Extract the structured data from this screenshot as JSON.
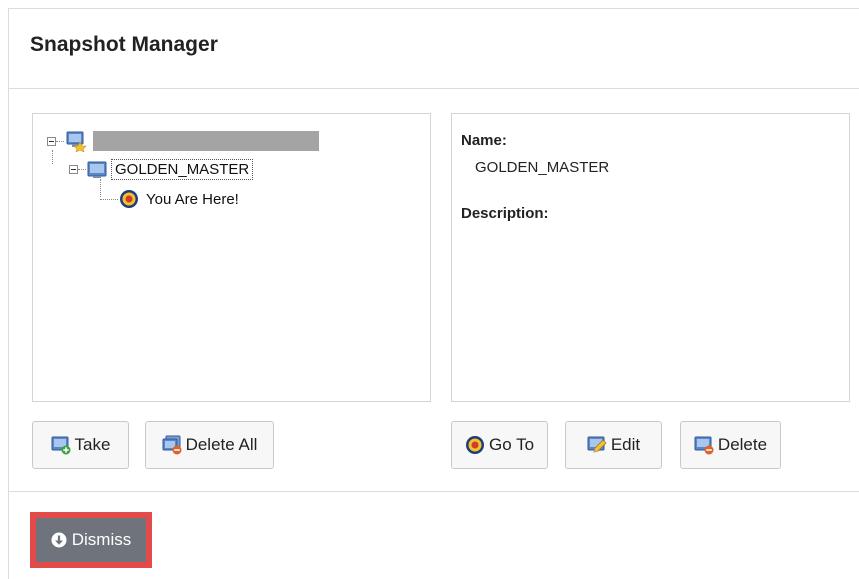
{
  "dialog": {
    "title": "Snapshot Manager"
  },
  "tree": {
    "host_name_redacted": "",
    "snapshot_node": "GOLDEN_MASTER",
    "current_state_node": "You Are Here!"
  },
  "details": {
    "name_label": "Name:",
    "name_value": "GOLDEN_MASTER",
    "description_label": "Description:",
    "description_value": ""
  },
  "buttons": {
    "take": "Take",
    "delete_all": "Delete All",
    "go_to": "Go To",
    "edit": "Edit",
    "delete": "Delete",
    "dismiss": "Dismiss"
  },
  "colors": {
    "dismiss_bg": "#6f747c",
    "highlight_outline": "#e34b4b",
    "redaction_bar": "#a4a4a4"
  },
  "icons": {
    "host": "vm-host-icon",
    "snapshot": "snapshot-icon",
    "you_are_here": "target-icon",
    "take": "take-snapshot-icon",
    "delete_all": "delete-all-snapshots-icon",
    "go_to": "target-icon",
    "edit": "edit-snapshot-icon",
    "delete": "delete-snapshot-icon",
    "dismiss": "arrow-down-circle-icon"
  }
}
